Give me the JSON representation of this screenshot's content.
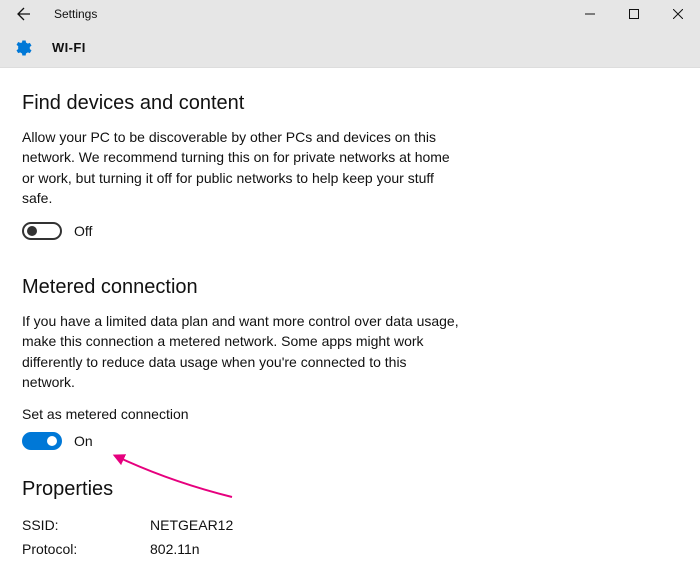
{
  "window": {
    "title": "Settings"
  },
  "page": {
    "title": "WI-FI"
  },
  "sections": {
    "find_devices": {
      "heading": "Find devices and content",
      "desc": "Allow your PC to be discoverable by other PCs and devices on this network. We recommend turning this on for private networks at home or work, but turning it off for public networks to help keep your stuff safe.",
      "toggle_label": "Off"
    },
    "metered": {
      "heading": "Metered connection",
      "desc": "If you have a limited data plan and want more control over data usage, make this connection a metered network. Some apps might work differently to reduce data usage when you're connected to this network.",
      "sub_label": "Set as metered connection",
      "toggle_label": "On"
    },
    "properties": {
      "heading": "Properties",
      "rows": [
        {
          "key": "SSID:",
          "val": "NETGEAR12"
        },
        {
          "key": "Protocol:",
          "val": "802.11n"
        }
      ]
    }
  }
}
